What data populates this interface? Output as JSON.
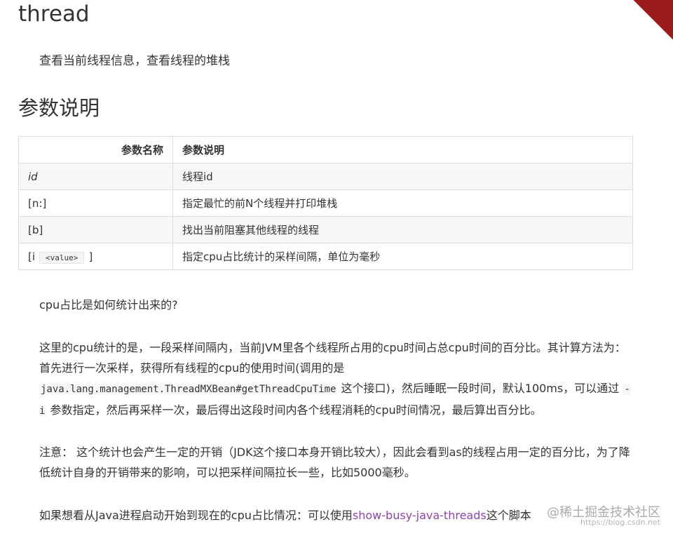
{
  "page": {
    "title": "thread",
    "intro": "查看当前线程信息，查看线程的堆栈",
    "section_title": "参数说明"
  },
  "table": {
    "headers": [
      "参数名称",
      "参数说明"
    ],
    "rows": [
      {
        "name": "id",
        "desc": "线程id"
      },
      {
        "name": "[n:]",
        "desc": "指定最忙的前N个线程并打印堆栈"
      },
      {
        "name": "[b]",
        "desc": "找出当前阻塞其他线程的线程"
      },
      {
        "name_prefix": "[i",
        "name_code": "<value>",
        "name_suffix": "]",
        "desc": "指定cpu占比统计的采样间隔，单位为毫秒"
      }
    ]
  },
  "content": {
    "question": "cpu占比是如何统计出来的?",
    "p1_a": "这里的cpu统计的是，一段采样间隔内，当前JVM里各个线程所占用的cpu时间占总cpu时间的百分比。其计算方法为： 首先进行一次采样，获得所有线程的cpu的使用时间(调用的是 ",
    "p1_code1": "java.lang.management.ThreadMXBean#getThreadCpuTime",
    "p1_b": " 这个接口)，然后睡眠一段时间，默认100ms，可以通过 ",
    "p1_code2": "-i",
    "p1_c": " 参数指定，然后再采样一次，最后得出这段时间内各个线程消耗的cpu时间情况，最后算出百分比。",
    "p2": "注意： 这个统计也会产生一定的开销（JDK这个接口本身开销比较大），因此会看到as的线程占用一定的百分比，为了降低统计自身的开销带来的影响，可以把采样间隔拉长一些，比如5000毫秒。",
    "p3_a": "如果想看从Java进程启动开始到现在的cpu占比情况：可以使用",
    "p3_link": "show-busy-java-threads",
    "p3_b": "这个脚本"
  },
  "watermark": {
    "line1": "@稀土掘金技术社区",
    "line2": "https://blog.csdn.net"
  },
  "colors": {
    "link": "#8e44ad",
    "ribbon": "#9b1c1c",
    "row_stripe": "#f7f7f7"
  }
}
